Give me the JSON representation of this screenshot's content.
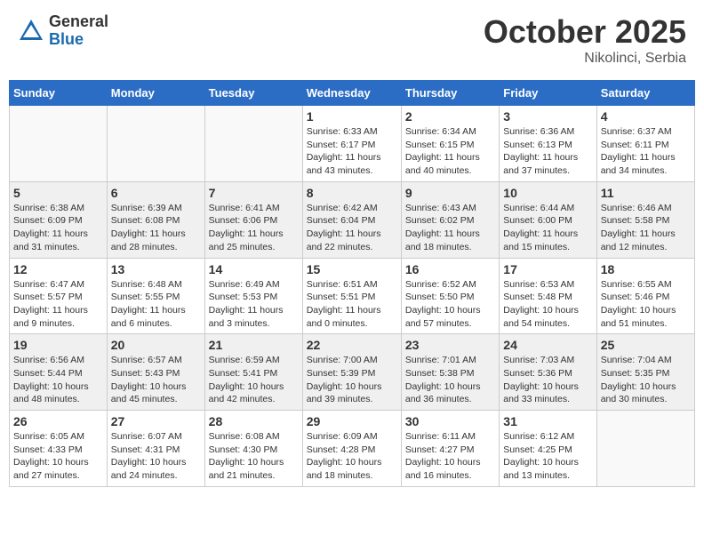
{
  "header": {
    "logo_general": "General",
    "logo_blue": "Blue",
    "month_title": "October 2025",
    "location": "Nikolinci, Serbia"
  },
  "weekdays": [
    "Sunday",
    "Monday",
    "Tuesday",
    "Wednesday",
    "Thursday",
    "Friday",
    "Saturday"
  ],
  "weeks": [
    [
      {
        "day": "",
        "info": ""
      },
      {
        "day": "",
        "info": ""
      },
      {
        "day": "",
        "info": ""
      },
      {
        "day": "1",
        "info": "Sunrise: 6:33 AM\nSunset: 6:17 PM\nDaylight: 11 hours\nand 43 minutes."
      },
      {
        "day": "2",
        "info": "Sunrise: 6:34 AM\nSunset: 6:15 PM\nDaylight: 11 hours\nand 40 minutes."
      },
      {
        "day": "3",
        "info": "Sunrise: 6:36 AM\nSunset: 6:13 PM\nDaylight: 11 hours\nand 37 minutes."
      },
      {
        "day": "4",
        "info": "Sunrise: 6:37 AM\nSunset: 6:11 PM\nDaylight: 11 hours\nand 34 minutes."
      }
    ],
    [
      {
        "day": "5",
        "info": "Sunrise: 6:38 AM\nSunset: 6:09 PM\nDaylight: 11 hours\nand 31 minutes."
      },
      {
        "day": "6",
        "info": "Sunrise: 6:39 AM\nSunset: 6:08 PM\nDaylight: 11 hours\nand 28 minutes."
      },
      {
        "day": "7",
        "info": "Sunrise: 6:41 AM\nSunset: 6:06 PM\nDaylight: 11 hours\nand 25 minutes."
      },
      {
        "day": "8",
        "info": "Sunrise: 6:42 AM\nSunset: 6:04 PM\nDaylight: 11 hours\nand 22 minutes."
      },
      {
        "day": "9",
        "info": "Sunrise: 6:43 AM\nSunset: 6:02 PM\nDaylight: 11 hours\nand 18 minutes."
      },
      {
        "day": "10",
        "info": "Sunrise: 6:44 AM\nSunset: 6:00 PM\nDaylight: 11 hours\nand 15 minutes."
      },
      {
        "day": "11",
        "info": "Sunrise: 6:46 AM\nSunset: 5:58 PM\nDaylight: 11 hours\nand 12 minutes."
      }
    ],
    [
      {
        "day": "12",
        "info": "Sunrise: 6:47 AM\nSunset: 5:57 PM\nDaylight: 11 hours\nand 9 minutes."
      },
      {
        "day": "13",
        "info": "Sunrise: 6:48 AM\nSunset: 5:55 PM\nDaylight: 11 hours\nand 6 minutes."
      },
      {
        "day": "14",
        "info": "Sunrise: 6:49 AM\nSunset: 5:53 PM\nDaylight: 11 hours\nand 3 minutes."
      },
      {
        "day": "15",
        "info": "Sunrise: 6:51 AM\nSunset: 5:51 PM\nDaylight: 11 hours\nand 0 minutes."
      },
      {
        "day": "16",
        "info": "Sunrise: 6:52 AM\nSunset: 5:50 PM\nDaylight: 10 hours\nand 57 minutes."
      },
      {
        "day": "17",
        "info": "Sunrise: 6:53 AM\nSunset: 5:48 PM\nDaylight: 10 hours\nand 54 minutes."
      },
      {
        "day": "18",
        "info": "Sunrise: 6:55 AM\nSunset: 5:46 PM\nDaylight: 10 hours\nand 51 minutes."
      }
    ],
    [
      {
        "day": "19",
        "info": "Sunrise: 6:56 AM\nSunset: 5:44 PM\nDaylight: 10 hours\nand 48 minutes."
      },
      {
        "day": "20",
        "info": "Sunrise: 6:57 AM\nSunset: 5:43 PM\nDaylight: 10 hours\nand 45 minutes."
      },
      {
        "day": "21",
        "info": "Sunrise: 6:59 AM\nSunset: 5:41 PM\nDaylight: 10 hours\nand 42 minutes."
      },
      {
        "day": "22",
        "info": "Sunrise: 7:00 AM\nSunset: 5:39 PM\nDaylight: 10 hours\nand 39 minutes."
      },
      {
        "day": "23",
        "info": "Sunrise: 7:01 AM\nSunset: 5:38 PM\nDaylight: 10 hours\nand 36 minutes."
      },
      {
        "day": "24",
        "info": "Sunrise: 7:03 AM\nSunset: 5:36 PM\nDaylight: 10 hours\nand 33 minutes."
      },
      {
        "day": "25",
        "info": "Sunrise: 7:04 AM\nSunset: 5:35 PM\nDaylight: 10 hours\nand 30 minutes."
      }
    ],
    [
      {
        "day": "26",
        "info": "Sunrise: 6:05 AM\nSunset: 4:33 PM\nDaylight: 10 hours\nand 27 minutes."
      },
      {
        "day": "27",
        "info": "Sunrise: 6:07 AM\nSunset: 4:31 PM\nDaylight: 10 hours\nand 24 minutes."
      },
      {
        "day": "28",
        "info": "Sunrise: 6:08 AM\nSunset: 4:30 PM\nDaylight: 10 hours\nand 21 minutes."
      },
      {
        "day": "29",
        "info": "Sunrise: 6:09 AM\nSunset: 4:28 PM\nDaylight: 10 hours\nand 18 minutes."
      },
      {
        "day": "30",
        "info": "Sunrise: 6:11 AM\nSunset: 4:27 PM\nDaylight: 10 hours\nand 16 minutes."
      },
      {
        "day": "31",
        "info": "Sunrise: 6:12 AM\nSunset: 4:25 PM\nDaylight: 10 hours\nand 13 minutes."
      },
      {
        "day": "",
        "info": ""
      }
    ]
  ]
}
